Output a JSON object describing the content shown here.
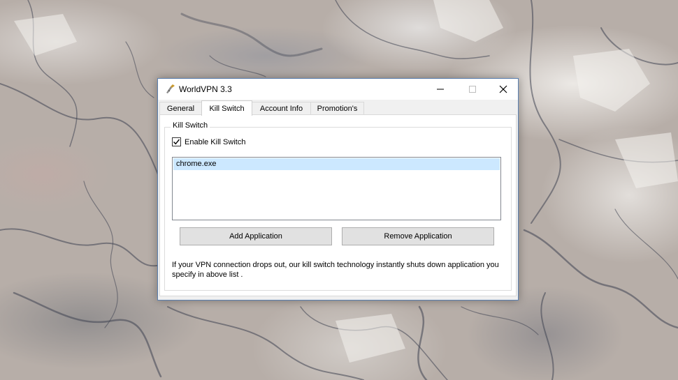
{
  "window": {
    "title": "WorldVPN 3.3",
    "accent_color": "#5a7fb0"
  },
  "tabs": [
    {
      "label": "General",
      "active": false
    },
    {
      "label": "Kill Switch",
      "active": true
    },
    {
      "label": "Account Info",
      "active": false
    },
    {
      "label": "Promotion's",
      "active": false
    }
  ],
  "kill_switch": {
    "group_label": "Kill Switch",
    "enable_checkbox": {
      "label": "Enable Kill Switch",
      "checked": true
    },
    "applications": [
      {
        "name": "chrome.exe",
        "selected": true
      }
    ],
    "add_button_label": "Add Application",
    "remove_button_label": "Remove Application",
    "note": "If your VPN connection drops out, our kill switch technology instantly shuts down application you specify in above list ."
  },
  "icons": {
    "app": "worldvpn-app-icon",
    "minimize": "minimize-icon",
    "maximize": "maximize-icon",
    "close": "close-icon",
    "check": "checkmark-icon"
  },
  "colors": {
    "selection": "#cce8ff",
    "button_face": "#e1e1e1",
    "dialog_background": "#f0f0f0"
  }
}
